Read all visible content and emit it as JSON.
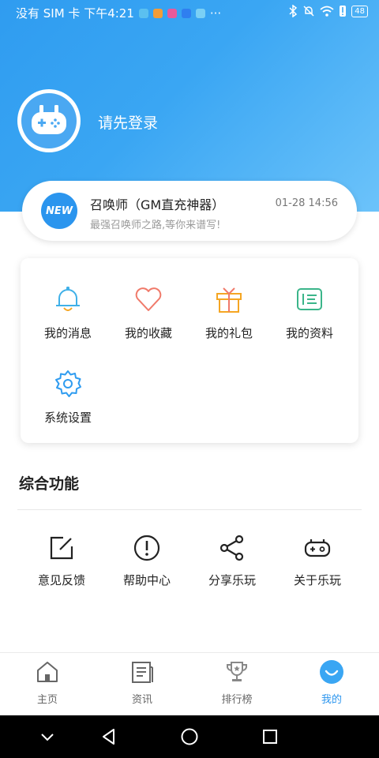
{
  "status_bar": {
    "left_text": "没有 SIM 卡 下午4:21",
    "more": "···",
    "battery": "48"
  },
  "profile": {
    "login_prompt": "请先登录"
  },
  "notice": {
    "badge": "NEW",
    "title": "召唤师（GM直充神器）",
    "subtitle": "最强召唤师之路,等你来谱写!",
    "time": "01-28 14:56"
  },
  "menu": {
    "items": [
      {
        "label": "我的消息",
        "icon": "bell-icon"
      },
      {
        "label": "我的收藏",
        "icon": "heart-icon"
      },
      {
        "label": "我的礼包",
        "icon": "gift-icon"
      },
      {
        "label": "我的资料",
        "icon": "profile-card-icon"
      },
      {
        "label": "系统设置",
        "icon": "gear-icon"
      }
    ]
  },
  "functions": {
    "title": "综合功能",
    "items": [
      {
        "label": "意见反馈",
        "icon": "edit-icon"
      },
      {
        "label": "帮助中心",
        "icon": "alert-icon"
      },
      {
        "label": "分享乐玩",
        "icon": "share-icon"
      },
      {
        "label": "关于乐玩",
        "icon": "gamepad-icon"
      }
    ]
  },
  "tabbar": {
    "items": [
      {
        "label": "主页",
        "icon": "home-icon"
      },
      {
        "label": "资讯",
        "icon": "news-icon"
      },
      {
        "label": "排行榜",
        "icon": "trophy-icon"
      },
      {
        "label": "我的",
        "icon": "profile-icon",
        "active": true
      }
    ]
  },
  "colors": {
    "accent": "#2b95ee",
    "hero_start": "#2f9cf0",
    "hero_end": "#6cc3fa",
    "bell": "#3fb0e8",
    "heart": "#f07a6a",
    "gift": "#f5a623",
    "profile_card": "#3bb58a",
    "gear": "#2f9cf0"
  }
}
